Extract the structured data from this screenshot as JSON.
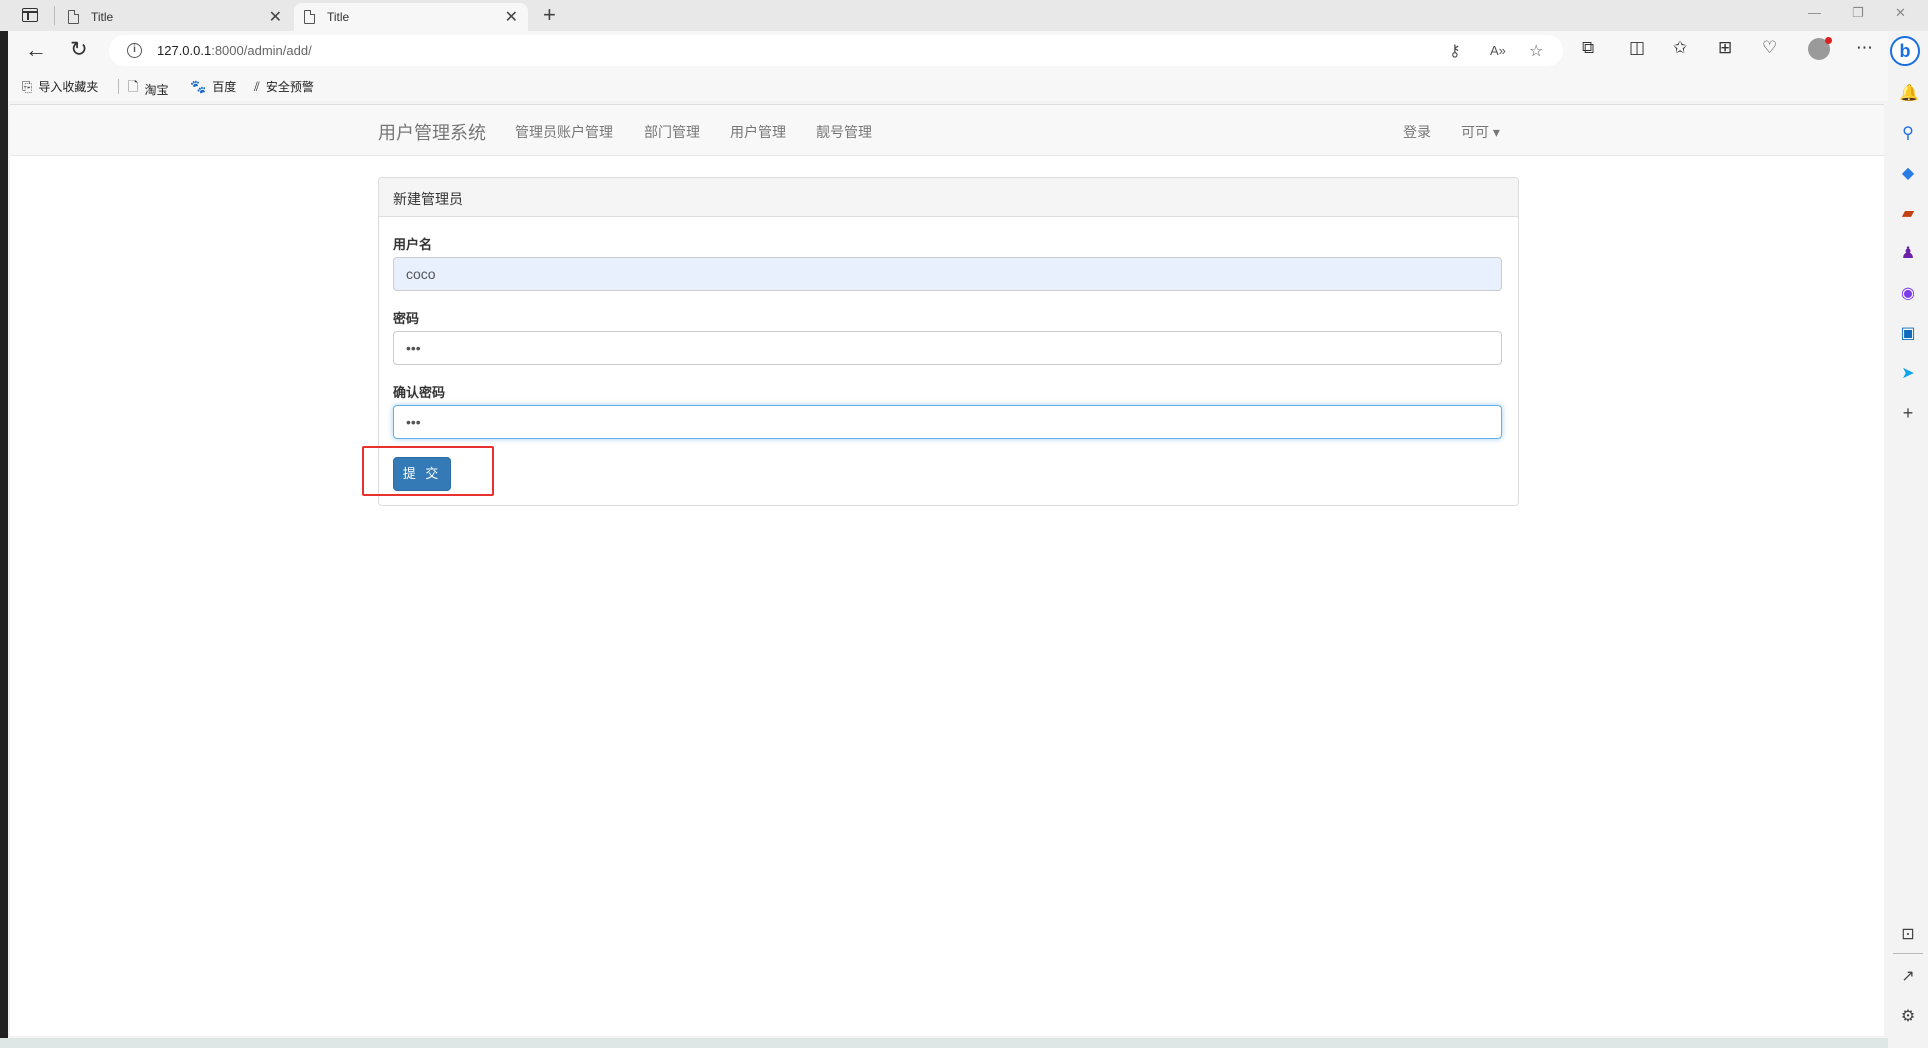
{
  "browser": {
    "tabs": [
      {
        "title": "Title",
        "active": false
      },
      {
        "title": "Title",
        "active": true
      }
    ],
    "address": {
      "host": "127.0.0.1",
      "rest": ":8000/admin/add/"
    },
    "bookmarks": [
      {
        "label": "导入收藏夹",
        "icon": "import-favorites-icon"
      },
      {
        "label": "淘宝",
        "icon": "page-icon"
      },
      {
        "label": "百度",
        "icon": "baidu-paw-icon"
      },
      {
        "label": "安全预警",
        "icon": "security-alert-icon"
      }
    ]
  },
  "navbar": {
    "brand": "用户管理系统",
    "links": [
      "管理员账户管理",
      "部门管理",
      "用户管理",
      "靓号管理"
    ],
    "login": "登录",
    "user": "可可 ▾"
  },
  "panel": {
    "title": "新建管理员",
    "fields": [
      {
        "label": "用户名",
        "value": "coco",
        "type": "text"
      },
      {
        "label": "密码",
        "value": "123",
        "type": "password"
      },
      {
        "label": "确认密码",
        "value": "123",
        "type": "password"
      }
    ],
    "submit_label": "提 交"
  },
  "colors": {
    "primary_button": "#337ab7",
    "highlight_box": "#e8302f",
    "autofill_bg": "#e8f0fe"
  }
}
